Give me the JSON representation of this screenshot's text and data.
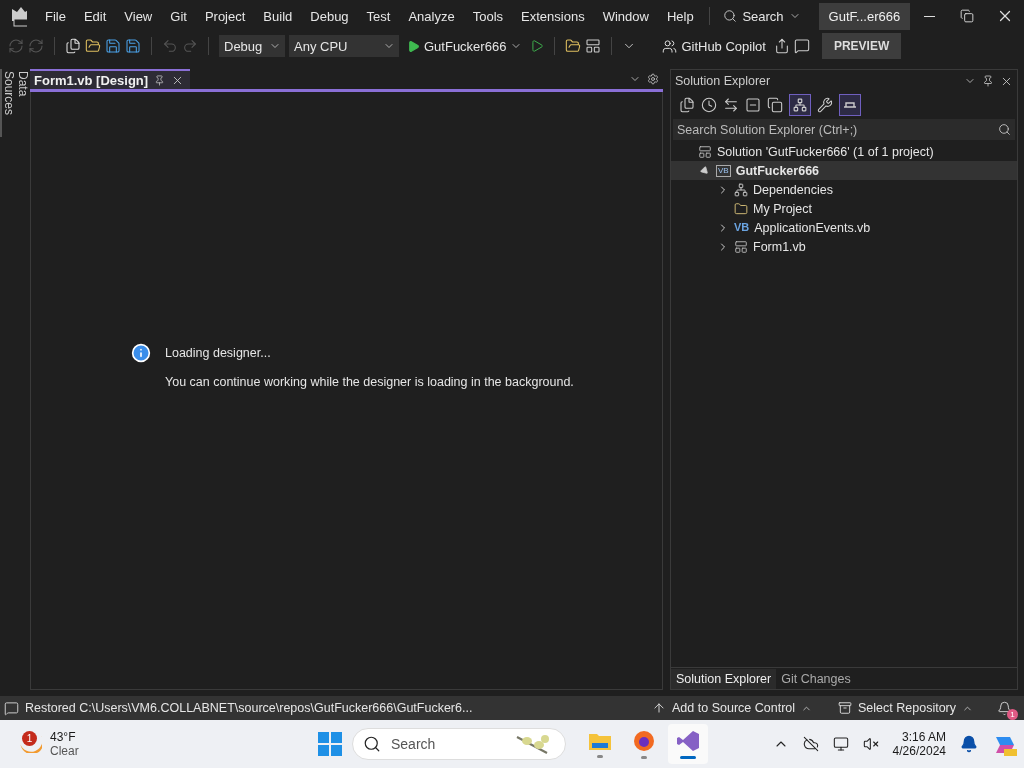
{
  "menu": [
    "File",
    "Edit",
    "View",
    "Git",
    "Project",
    "Build",
    "Debug",
    "Test",
    "Analyze",
    "Tools",
    "Extensions",
    "Window",
    "Help"
  ],
  "search": {
    "label": "Search"
  },
  "solution_badge": "GutF...er666",
  "toolbar": {
    "configuration": "Debug",
    "platform": "Any CPU",
    "start": "GutFucker666",
    "copilot": "GitHub Copilot",
    "preview": "PREVIEW"
  },
  "side_tab": "Data Sources",
  "document_tab": {
    "title": "Form1.vb [Design]",
    "selected": true
  },
  "designer": {
    "title": "Loading designer...",
    "message": "You can continue working while the designer is loading in the background."
  },
  "solution_explorer": {
    "title": "Solution Explorer",
    "search_placeholder": "Search Solution Explorer (Ctrl+;)",
    "tree": [
      {
        "label": "Solution 'GutFucker666' (1 of 1 project)",
        "kind": "solution",
        "selected": false,
        "children": [
          {
            "label": "GutFucker666",
            "kind": "project",
            "icon_text": "VB",
            "selected": true,
            "expanded": true,
            "children": [
              {
                "label": "Dependencies",
                "kind": "dependencies",
                "selected": false,
                "expanded": false
              },
              {
                "label": "My Project",
                "kind": "myproject",
                "selected": false
              },
              {
                "label": "ApplicationEvents.vb",
                "kind": "vb",
                "icon_text": "VB",
                "selected": false,
                "expanded": false
              },
              {
                "label": "Form1.vb",
                "kind": "form",
                "selected": false,
                "expanded": false
              }
            ]
          }
        ]
      }
    ],
    "bottom_tabs": [
      {
        "label": "Solution Explorer",
        "selected": true
      },
      {
        "label": "Git Changes",
        "selected": false
      }
    ]
  },
  "status_bar": {
    "message": "Restored C:\\Users\\VM6.COLLABNET\\source\\repos\\GutFucker666\\GutFucker6...",
    "source_control": "Add to Source Control",
    "repository": "Select Repository",
    "notifications": "1"
  },
  "taskbar": {
    "temperature": "43°F",
    "condition": "Clear",
    "weather_badge": "1",
    "search": "Search",
    "apps": [
      {
        "kind": "explorer",
        "selected": false
      },
      {
        "kind": "browser",
        "selected": false
      },
      {
        "kind": "studio",
        "selected": true
      }
    ],
    "time": "3:16 AM",
    "date": "4/26/2024"
  }
}
